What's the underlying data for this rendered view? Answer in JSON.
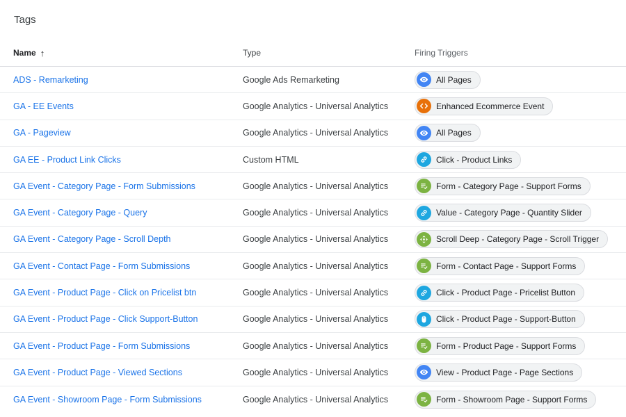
{
  "page": {
    "title": "Tags"
  },
  "columns": {
    "name": "Name",
    "type": "Type",
    "triggers": "Firing Triggers"
  },
  "colors": {
    "link": "#1a73e8",
    "page-view": "#4285f4",
    "custom-event": "#e8710a",
    "click": "#1ea7e0",
    "form": "#7cb342",
    "scroll": "#7cb342"
  },
  "rows": [
    {
      "name": "ADS - Remarketing",
      "type": "Google Ads Remarketing",
      "trigger": "All Pages",
      "icon": "eye-icon"
    },
    {
      "name": "GA - EE Events",
      "type": "Google Analytics - Universal Analytics",
      "trigger": "Enhanced Ecommerce Event",
      "icon": "code-icon"
    },
    {
      "name": "GA - Pageview",
      "type": "Google Analytics - Universal Analytics",
      "trigger": "All Pages",
      "icon": "eye-icon"
    },
    {
      "name": "GA EE - Product Link Clicks",
      "type": "Custom HTML",
      "trigger": "Click - Product Links",
      "icon": "link-icon"
    },
    {
      "name": "GA Event - Category Page - Form Submissions",
      "type": "Google Analytics - Universal Analytics",
      "trigger": "Form - Category Page - Support Forms",
      "icon": "form-icon"
    },
    {
      "name": "GA Event - Category Page - Query",
      "type": "Google Analytics - Universal Analytics",
      "trigger": "Value - Category Page - Quantity Slider",
      "icon": "link-icon"
    },
    {
      "name": "GA Event - Category Page - Scroll Depth",
      "type": "Google Analytics - Universal Analytics",
      "trigger": "Scroll Deep - Category Page - Scroll Trigger",
      "icon": "scroll-icon"
    },
    {
      "name": "GA Event - Contact Page - Form Submissions",
      "type": "Google Analytics - Universal Analytics",
      "trigger": "Form - Contact Page - Support Forms",
      "icon": "form-icon"
    },
    {
      "name": "GA Event - Product Page - Click on Pricelist btn",
      "type": "Google Analytics - Universal Analytics",
      "trigger": "Click - Product Page - Pricelist Button",
      "icon": "link-icon"
    },
    {
      "name": "GA Event - Product Page - Click Support-Button",
      "type": "Google Analytics - Universal Analytics",
      "trigger": "Click - Product Page - Support-Button",
      "icon": "mouse-icon"
    },
    {
      "name": "GA Event - Product Page - Form Submissions",
      "type": "Google Analytics - Universal Analytics",
      "trigger": "Form - Product Page - Support Forms",
      "icon": "form-icon"
    },
    {
      "name": "GA Event - Product Page - Viewed Sections",
      "type": "Google Analytics - Universal Analytics",
      "trigger": "View - Product Page - Page Sections",
      "icon": "eye-icon"
    },
    {
      "name": "GA Event - Showroom Page - Form Submissions",
      "type": "Google Analytics - Universal Analytics",
      "trigger": "Form - Showroom Page - Support Forms",
      "icon": "form-icon"
    }
  ]
}
